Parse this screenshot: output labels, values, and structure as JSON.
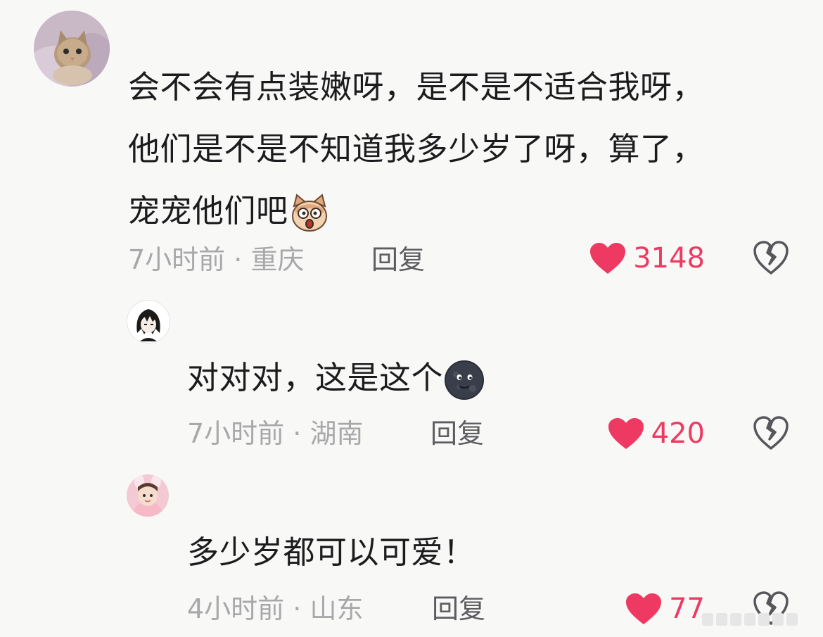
{
  "comments": [
    {
      "lines": [
        "会不会有点装嫩呀，是不是不适合我呀，",
        "他们是不是不知道我多少岁了呀，算了，",
        "宠宠他们吧"
      ],
      "emoji": "shocked-cat-face-icon",
      "time": "7小时前",
      "location": "重庆",
      "reply_label": "回复",
      "likes": "3148"
    },
    {
      "lines": [
        "对对对，这是这个"
      ],
      "emoji": "new-moon-face-icon",
      "time": "7小时前",
      "location": "湖南",
      "reply_label": "回复",
      "likes": "420"
    },
    {
      "lines": [
        "多少岁都可以可爱！"
      ],
      "time": "4小时前",
      "location": "山东",
      "reply_label": "回复",
      "likes": "77"
    }
  ],
  "colors": {
    "background": "#f8f8f7",
    "like_red": "#ee3a63",
    "meta_gray": "#a8a8ab",
    "reply_gray": "#5d5d61"
  }
}
